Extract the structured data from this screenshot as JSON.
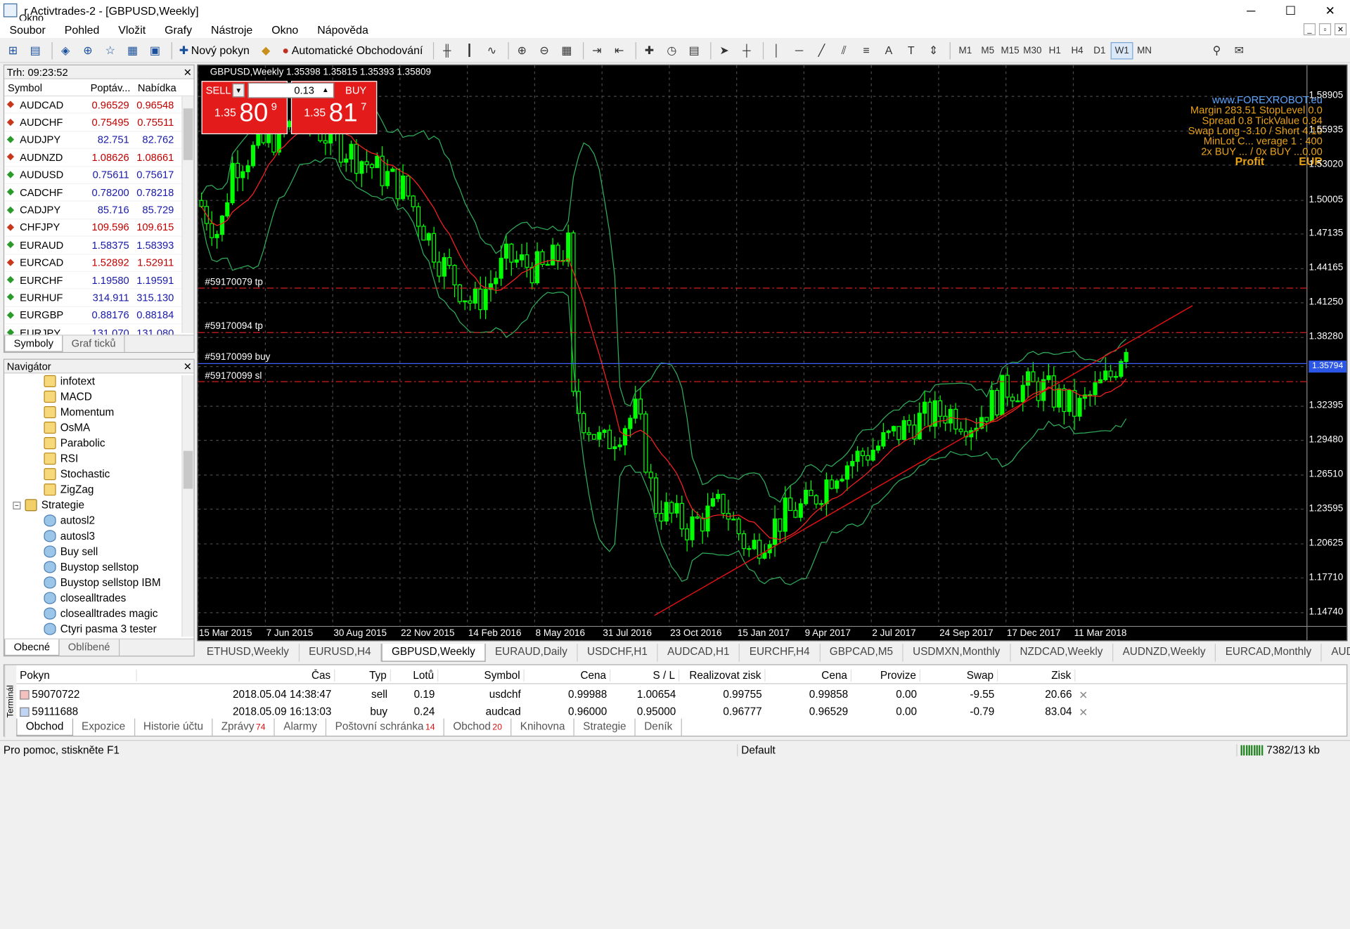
{
  "window": {
    "title": "r Activtrades-2 - [GBPUSD,Weekly]",
    "overlay": "Okno",
    "min": "─",
    "max": "☐",
    "close": "✕"
  },
  "menu": [
    "Soubor",
    "Pohled",
    "Vložit",
    "Grafy",
    "Nástroje",
    "Okno",
    "Nápověda"
  ],
  "toolbar": {
    "new_order": "Nový pokyn",
    "auto_trading": "Automatické Obchodování",
    "timeframes": [
      "M1",
      "M5",
      "M15",
      "M30",
      "H1",
      "H4",
      "D1",
      "W1",
      "MN"
    ],
    "active_tf": "W1"
  },
  "market_watch": {
    "title": "Trh: 09:23:52",
    "cols": [
      "Symbol",
      "Poptáv...",
      "Nabídka"
    ],
    "rows": [
      {
        "s": "AUDCAD",
        "b": "0.96529",
        "a": "0.96548",
        "d": "down"
      },
      {
        "s": "AUDCHF",
        "b": "0.75495",
        "a": "0.75511",
        "d": "down"
      },
      {
        "s": "AUDJPY",
        "b": "82.751",
        "a": "82.762",
        "d": "up"
      },
      {
        "s": "AUDNZD",
        "b": "1.08626",
        "a": "1.08661",
        "d": "down"
      },
      {
        "s": "AUDUSD",
        "b": "0.75611",
        "a": "0.75617",
        "d": "up"
      },
      {
        "s": "CADCHF",
        "b": "0.78200",
        "a": "0.78218",
        "d": "up"
      },
      {
        "s": "CADJPY",
        "b": "85.716",
        "a": "85.729",
        "d": "up"
      },
      {
        "s": "CHFJPY",
        "b": "109.596",
        "a": "109.615",
        "d": "down"
      },
      {
        "s": "EURAUD",
        "b": "1.58375",
        "a": "1.58393",
        "d": "up"
      },
      {
        "s": "EURCAD",
        "b": "1.52892",
        "a": "1.52911",
        "d": "down"
      },
      {
        "s": "EURCHF",
        "b": "1.19580",
        "a": "1.19591",
        "d": "up"
      },
      {
        "s": "EURHUF",
        "b": "314.911",
        "a": "315.130",
        "d": "up"
      },
      {
        "s": "EURGBP",
        "b": "0.88176",
        "a": "0.88184",
        "d": "up"
      },
      {
        "s": "EURJPY",
        "b": "131.070",
        "a": "131.080",
        "d": "up"
      }
    ],
    "tabs": [
      "Symboly",
      "Graf ticků"
    ]
  },
  "navigator": {
    "title": "Navigátor",
    "items": [
      {
        "t": "infotext",
        "k": "ind",
        "l": 1
      },
      {
        "t": "MACD",
        "k": "ind",
        "l": 1
      },
      {
        "t": "Momentum",
        "k": "ind",
        "l": 1
      },
      {
        "t": "OsMA",
        "k": "ind",
        "l": 1
      },
      {
        "t": "Parabolic",
        "k": "ind",
        "l": 1
      },
      {
        "t": "RSI",
        "k": "ind",
        "l": 1
      },
      {
        "t": "Stochastic",
        "k": "ind",
        "l": 1
      },
      {
        "t": "ZigZag",
        "k": "ind",
        "l": 1
      },
      {
        "t": "Strategie",
        "k": "fold",
        "l": 0
      },
      {
        "t": "autosl2",
        "k": "ea",
        "l": 1
      },
      {
        "t": "autosl3",
        "k": "ea",
        "l": 1
      },
      {
        "t": "Buy sell",
        "k": "ea",
        "l": 1
      },
      {
        "t": "Buystop sellstop",
        "k": "ea",
        "l": 1
      },
      {
        "t": "Buystop sellstop IBM",
        "k": "ea",
        "l": 1
      },
      {
        "t": "closealltrades",
        "k": "ea",
        "l": 1
      },
      {
        "t": "closealltrades magic",
        "k": "ea",
        "l": 1
      },
      {
        "t": "Ctyri pasma 3 tester",
        "k": "ea",
        "l": 1
      }
    ],
    "tabs": [
      "Obecné",
      "Oblíbené"
    ]
  },
  "chart": {
    "title": "GBPUSD,Weekly  1.35398 1.35815 1.35393 1.35809",
    "sell_label": "SELL",
    "buy_label": "BUY",
    "lot": "0.13",
    "sell_price": {
      "pre": "1.35",
      "big": "80",
      "sup": "9"
    },
    "buy_price": {
      "pre": "1.35",
      "big": "81",
      "sup": "7"
    },
    "info": {
      "site": "www.FOREXROBOT.eu",
      "l1": "Margin 283.51  StopLevel 0.0",
      "l2": "Spread 0.8  TickValue 0.84",
      "l3": "Swap Long -3.10 / Short 4.10",
      "l4": "MinLot C...  verage 1 : 400",
      "l5": "2x BUY ... / 0x BUY ...0.00",
      "profit": "Profit",
      "cur": "EUR"
    },
    "yticks": [
      "1.58905",
      "1.55935",
      "1.53020",
      "1.50005",
      "1.47135",
      "1.44165",
      "1.41250",
      "1.38280",
      "1.35794",
      "1.32395",
      "1.29480",
      "1.26510",
      "1.23595",
      "1.20625",
      "1.17710",
      "1.14740"
    ],
    "current_price": "1.35794",
    "xticks": [
      "15 Mar 2015",
      "7 Jun 2015",
      "30 Aug 2015",
      "22 Nov 2015",
      "14 Feb 2016",
      "8 May 2016",
      "31 Jul 2016",
      "23 Oct 2016",
      "15 Jan 2017",
      "9 Apr 2017",
      "2 Jul 2017",
      "24 Sep 2017",
      "17 Dec 2017",
      "11 Mar 2018"
    ],
    "orders": [
      {
        "label": "#59170079 tp",
        "price": 1.425
      },
      {
        "label": "#59170094 tp",
        "price": 1.387
      },
      {
        "label": "#59170099 buy",
        "price": 1.3605
      },
      {
        "label": "#59170099 sl",
        "price": 1.345
      }
    ],
    "colors": {
      "bull": "#00ff00",
      "bear": "#000000",
      "ma": "#ff2020",
      "bands": "#2fae5b",
      "trend": "#e01010"
    }
  },
  "chart_tabs": [
    "ETHUSD,Weekly",
    "EURUSD,H4",
    "GBPUSD,Weekly",
    "EURAUD,Daily",
    "USDCHF,H1",
    "AUDCAD,H1",
    "EURCHF,H4",
    "GBPCAD,M5",
    "USDMXN,Monthly",
    "NZDCAD,Weekly",
    "AUDNZD,Weekly",
    "EURCAD,Monthly",
    "AUDUSD,W"
  ],
  "active_chart_tab": "GBPUSD,Weekly",
  "terminal": {
    "side": "Terminál",
    "cols": [
      "Pokyn",
      "Čas",
      "Typ",
      "Lotů",
      "Symbol",
      "Cena",
      "S / L",
      "Realizovat zisk",
      "Cena",
      "Provize",
      "Swap",
      "Zisk"
    ],
    "rows": [
      [
        "59070722",
        "2018.05.04 14:38:47",
        "sell",
        "0.19",
        "usdchf",
        "0.99988",
        "1.00654",
        "0.99755",
        "0.99858",
        "0.00",
        "-9.55",
        "20.66"
      ],
      [
        "59111688",
        "2018.05.09 16:13:03",
        "buy",
        "0.24",
        "audcad",
        "0.96000",
        "0.95000",
        "0.96777",
        "0.96529",
        "0.00",
        "-0.79",
        "83.04"
      ]
    ],
    "tabs": [
      {
        "t": "Obchod",
        "b": ""
      },
      {
        "t": "Expozice",
        "b": ""
      },
      {
        "t": "Historie účtu",
        "b": ""
      },
      {
        "t": "Zprávy",
        "b": "74"
      },
      {
        "t": "Alarmy",
        "b": ""
      },
      {
        "t": "Poštovní schránka",
        "b": "14"
      },
      {
        "t": "Obchod",
        "b": "20"
      },
      {
        "t": "Knihovna",
        "b": ""
      },
      {
        "t": "Strategie",
        "b": ""
      },
      {
        "t": "Deník",
        "b": ""
      }
    ]
  },
  "status": {
    "help": "Pro pomoc, stiskněte F1",
    "profile": "Default",
    "traffic": "7382/13 kb"
  }
}
